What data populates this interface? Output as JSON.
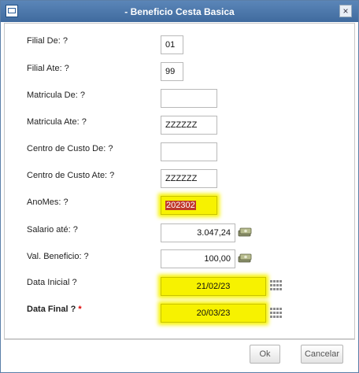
{
  "window": {
    "title": "- Beneficio Cesta Basica",
    "close_label": "×"
  },
  "fields": [
    {
      "label": "Filial De: ?",
      "value": "01"
    },
    {
      "label": "Filial Ate: ?",
      "value": "99"
    },
    {
      "label": "Matricula De: ?",
      "value": ""
    },
    {
      "label": "Matricula Ate: ?",
      "value": "ZZZZZZ"
    },
    {
      "label": "Centro de Custo De: ?",
      "value": ""
    },
    {
      "label": "Centro de Custo Ate: ?",
      "value": "ZZZZZZ"
    },
    {
      "label": "AnoMes: ?",
      "value": "202302"
    },
    {
      "label": "Salario até: ?",
      "value": "3.047,24"
    },
    {
      "label": "Val. Beneficio: ?",
      "value": "100,00"
    },
    {
      "label": "Data Inicial ?",
      "value": "21/02/23"
    },
    {
      "label": "Data Final ?",
      "required_mark": "*",
      "value": "20/03/23"
    }
  ],
  "icons": {
    "money": "money-icon",
    "calendar": "calendar-icon",
    "app": "window-icon"
  },
  "colors": {
    "highlight": "#f7f200",
    "title_bar": "#4a78ad",
    "required": "#dd0000"
  },
  "buttons": {
    "ok": "Ok",
    "cancel": "Cancelar"
  }
}
